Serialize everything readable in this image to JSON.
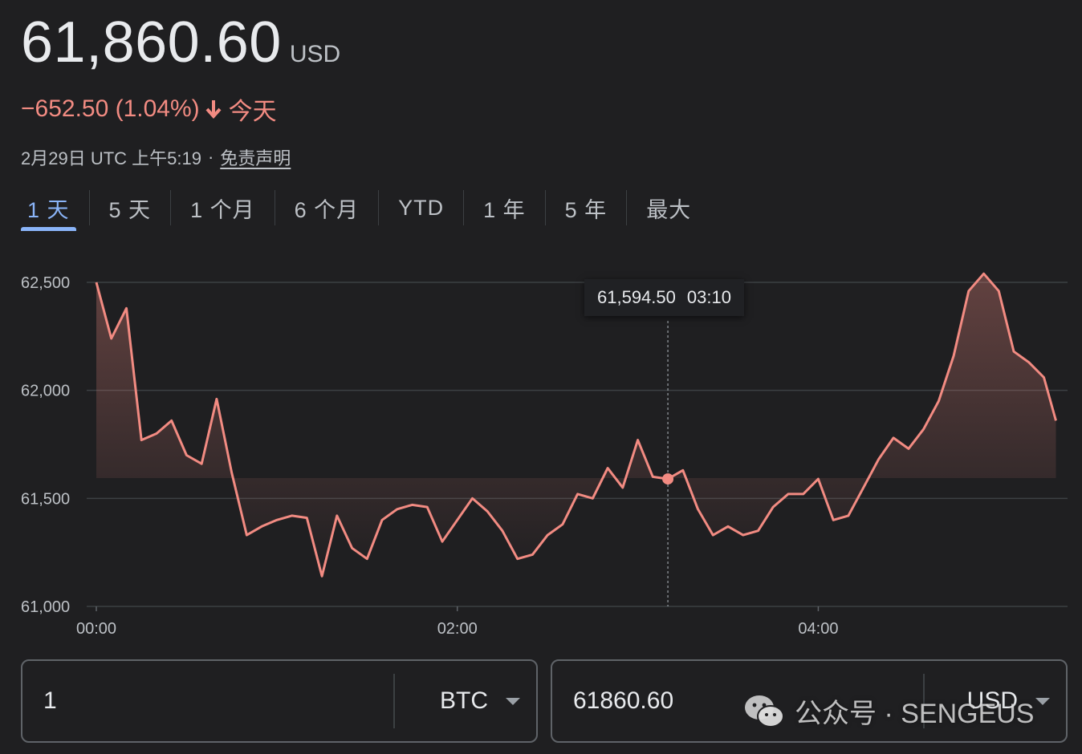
{
  "header": {
    "price": "61,860.60",
    "currency": "USD",
    "change": "−652.50 (1.04%)",
    "period": "今天",
    "timestamp": "2月29日 UTC 上午5:19",
    "separator": "·",
    "disclaimer": "免责声明"
  },
  "tabs": [
    {
      "label": "1 天",
      "active": true
    },
    {
      "label": "5 天"
    },
    {
      "label": "1 个月"
    },
    {
      "label": "6 个月"
    },
    {
      "label": "YTD"
    },
    {
      "label": "1 年"
    },
    {
      "label": "5 年"
    },
    {
      "label": "最大"
    }
  ],
  "tooltip": {
    "value": "61,594.50",
    "time": "03:10"
  },
  "chart_data": {
    "type": "line",
    "title": "",
    "xlabel": "",
    "ylabel": "",
    "x_ticks": [
      {
        "label": "00:00",
        "min": 0
      },
      {
        "label": "02:00",
        "min": 120
      },
      {
        "label": "04:00",
        "min": 240
      }
    ],
    "y_ticks": [
      {
        "label": "62,500",
        "value": 62500
      },
      {
        "label": "62,000",
        "value": 62000
      },
      {
        "label": "61,500",
        "value": 61500
      },
      {
        "label": "61,000",
        "value": 61000
      }
    ],
    "ylim": [
      61000,
      62500
    ],
    "xlim": [
      0,
      325
    ],
    "grid": true,
    "line_color": "#f28b82",
    "cursor_min": 190,
    "series": [
      {
        "x": [
          0,
          5,
          10,
          15,
          20,
          25,
          30,
          35,
          40,
          45,
          50,
          55,
          60,
          65,
          70,
          75,
          80,
          85,
          90,
          95,
          100,
          105,
          110,
          115,
          120,
          125,
          130,
          135,
          140,
          145,
          150,
          155,
          160,
          165,
          170,
          175,
          180,
          185,
          190,
          195,
          200,
          205,
          210,
          215,
          220,
          225,
          230,
          235,
          240,
          245,
          250,
          255,
          260,
          265,
          270,
          275,
          280,
          285,
          290,
          295,
          300,
          305,
          310,
          315,
          319
        ],
        "y": [
          62500,
          62240,
          62380,
          61770,
          61800,
          61860,
          61700,
          61660,
          61960,
          61620,
          61330,
          61370,
          61400,
          61420,
          61410,
          61140,
          61420,
          61270,
          61220,
          61400,
          61450,
          61470,
          61460,
          61300,
          61400,
          61500,
          61440,
          61350,
          61220,
          61240,
          61330,
          61380,
          61520,
          61500,
          61640,
          61550,
          61770,
          61600,
          61590,
          61630,
          61450,
          61330,
          61370,
          61330,
          61350,
          61460,
          61520,
          61520,
          61590,
          61400,
          61420,
          61550,
          61680,
          61780,
          61730,
          61820,
          61950,
          62160,
          62460,
          62540,
          62460,
          62180,
          62130,
          62060,
          61860
        ]
      }
    ]
  },
  "converter": {
    "from_amount": "1",
    "from_currency": "BTC",
    "to_amount": "61860.60",
    "to_currency": "USD"
  },
  "watermark": {
    "text": "公众号 · SENGEUS"
  }
}
